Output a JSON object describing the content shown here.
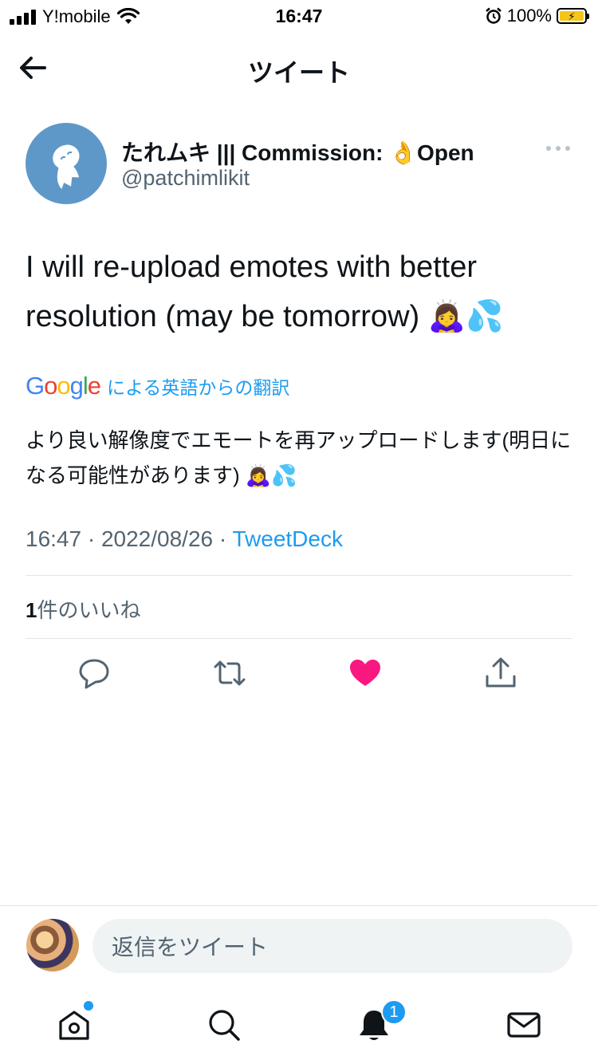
{
  "status_bar": {
    "carrier": "Y!mobile",
    "time": "16:47",
    "battery": "100%"
  },
  "header": {
    "title": "ツイート"
  },
  "tweet": {
    "author_name": "たれムキ ||| Commission: 👌Open",
    "author_handle": "@patchimlikit",
    "text": "I will re-upload emotes with better resolution (may be tomorrow) 🙇‍♀️💦",
    "translation_label": "による英語からの翻訳",
    "translated_text": "より良い解像度でエモートを再アップロードします(明日になる可能性があります) 🙇‍♀️💦",
    "timestamp": "16:47 · 2022/08/26 · ",
    "source": "TweetDeck",
    "likes_count": "1",
    "likes_label": "件のいいね"
  },
  "actions": [
    "reply-icon",
    "retweet-icon",
    "heart-icon",
    "share-icon"
  ],
  "reply": {
    "placeholder": "返信をツイート"
  },
  "tabs": [
    "home-icon",
    "search-icon",
    "notifications-icon",
    "messages-icon"
  ],
  "notification_badge": "1",
  "colors": {
    "accent": "#1d9bf0",
    "like": "#f91880",
    "avatar_bg": "#5e98c9"
  }
}
